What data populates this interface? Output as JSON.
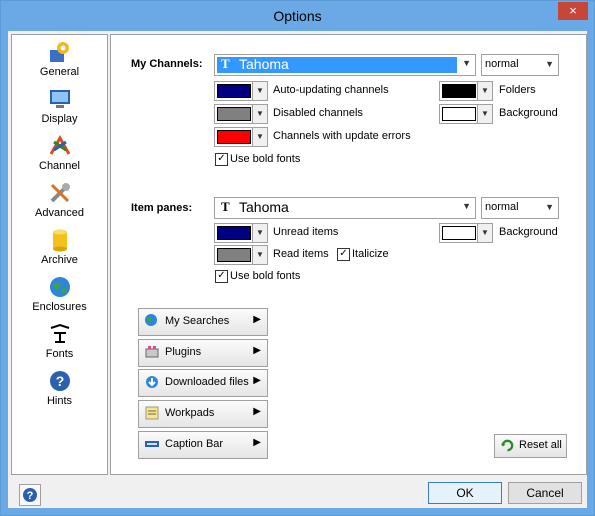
{
  "window": {
    "title": "Options",
    "close_glyph": "×"
  },
  "sidebar": {
    "items": [
      {
        "label": "General",
        "icon": "gear-icon"
      },
      {
        "label": "Display",
        "icon": "monitor-icon"
      },
      {
        "label": "Channel",
        "icon": "channel-icon"
      },
      {
        "label": "Advanced",
        "icon": "tools-icon"
      },
      {
        "label": "Archive",
        "icon": "database-icon"
      },
      {
        "label": "Enclosures",
        "icon": "globe-icon"
      },
      {
        "label": "Fonts",
        "icon": "fonts-icon",
        "selected": true
      },
      {
        "label": "Hints",
        "icon": "help-icon"
      }
    ]
  },
  "channels": {
    "label": "My Channels:",
    "font_glyph": "T",
    "font": "Tahoma",
    "style": "normal",
    "auto_updating": {
      "label": "Auto-updating channels",
      "color": "#000080"
    },
    "disabled": {
      "label": "Disabled channels",
      "color": "#808080"
    },
    "errors": {
      "label": "Channels with update errors",
      "color": "#ff0000"
    },
    "folders": {
      "label": "Folders",
      "color": "#000000"
    },
    "background": {
      "label": "Background",
      "color": "#ffffff"
    },
    "bold": {
      "label": "Use bold fonts",
      "checked": true
    }
  },
  "item_panes": {
    "label": "Item panes:",
    "font_glyph": "T",
    "font": "Tahoma",
    "style": "normal",
    "unread": {
      "label": "Unread items",
      "color": "#000080"
    },
    "read": {
      "label": "Read items",
      "color": "#808080"
    },
    "italicize": {
      "label": "Italicize",
      "checked": true
    },
    "background": {
      "label": "Background",
      "color": "#ffffff"
    },
    "bold": {
      "label": "Use bold fonts",
      "checked": true
    }
  },
  "nav_buttons": [
    {
      "label": "My Searches",
      "icon": "search-globe-icon"
    },
    {
      "label": "Plugins",
      "icon": "plugin-icon"
    },
    {
      "label": "Downloaded files",
      "icon": "download-icon"
    },
    {
      "label": "Workpads",
      "icon": "workpad-icon"
    },
    {
      "label": "Caption Bar",
      "icon": "caption-bar-icon"
    }
  ],
  "reset_label": "Reset all",
  "footer": {
    "ok": "OK",
    "cancel": "Cancel",
    "help_glyph": "?"
  },
  "glyphs": {
    "dropdown": "▼",
    "arrow_right": "▶",
    "check": "✓"
  }
}
